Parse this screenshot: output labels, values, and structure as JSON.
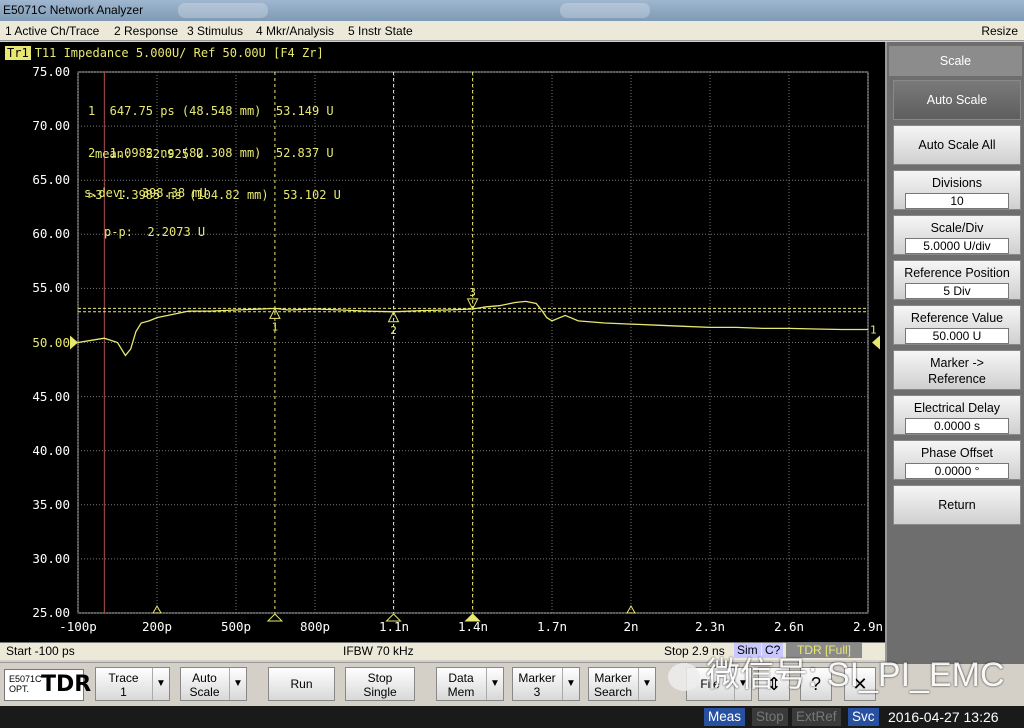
{
  "window": {
    "title": "E5071C Network Analyzer"
  },
  "menu": {
    "items": [
      "1 Active Ch/Trace",
      "2 Response",
      "3 Stimulus",
      "4 Mkr/Analysis",
      "5 Instr State"
    ],
    "resize": "Resize"
  },
  "trace": {
    "tag": "Tr1",
    "header": "T11 Impedance 5.000U/ Ref 50.00U [F4 Zr]"
  },
  "markers_table": [
    "1  647.75 ps (48.548 mm)  53.149 U",
    "2  1.0982 ns (82.308 mm)  52.837 U",
    ">3  1.3985 ns (104.82 mm)  53.102 U"
  ],
  "stats": {
    "mean": "mean:  52.925 U",
    "sdev": "s.dev:  398.38 mU",
    "pp": "p-p:  2.2073 U"
  },
  "chart_data": {
    "type": "line",
    "title": "T11 Impedance",
    "xlabel": "",
    "ylabel": "",
    "x_unit": "ps",
    "y_unit": "U",
    "xlim": [
      -100,
      2900
    ],
    "ylim": [
      25,
      75
    ],
    "yticks": [
      "75.00",
      "70.00",
      "65.00",
      "60.00",
      "55.00",
      "50.00",
      "45.00",
      "40.00",
      "35.00",
      "30.00",
      "25.00"
    ],
    "yticks_values": [
      75,
      70,
      65,
      60,
      55,
      50,
      45,
      40,
      35,
      30,
      25
    ],
    "xticks": [
      "-100p",
      "200p",
      "500p",
      "800p",
      "1.1n",
      "1.4n",
      "1.7n",
      "2n",
      "2.3n",
      "2.6n",
      "2.9n"
    ],
    "xticks_values": [
      -100,
      200,
      500,
      800,
      1100,
      1400,
      1700,
      2000,
      2300,
      2600,
      2900
    ],
    "reference_value": 50,
    "series": [
      {
        "color": "#e8e870",
        "x": [
          -100,
          -50,
          0,
          50,
          80,
          100,
          120,
          140,
          170,
          200,
          260,
          320,
          400,
          500,
          600,
          648,
          700,
          800,
          900,
          1000,
          1098,
          1200,
          1300,
          1399,
          1450,
          1500,
          1560,
          1600,
          1640,
          1660,
          1680,
          1700,
          1720,
          1750,
          1800,
          1900,
          2000,
          2100,
          2200,
          2300,
          2400,
          2500,
          2600,
          2700,
          2800,
          2900
        ],
        "y": [
          50.0,
          50.2,
          50.4,
          50.0,
          48.8,
          49.4,
          51.0,
          51.8,
          52.0,
          52.3,
          52.6,
          52.9,
          52.9,
          53.0,
          53.1,
          53.15,
          53.0,
          53.1,
          53.0,
          52.9,
          52.84,
          52.95,
          53.0,
          53.1,
          53.3,
          53.4,
          53.7,
          53.8,
          53.6,
          53.0,
          52.3,
          52.0,
          52.2,
          52.5,
          52.0,
          51.8,
          51.7,
          51.6,
          51.5,
          51.4,
          51.4,
          51.3,
          51.3,
          51.25,
          51.2,
          51.2
        ]
      }
    ],
    "markers": [
      {
        "label": "1",
        "x": 647.75,
        "y": 53.149
      },
      {
        "label": "2",
        "x": 1098.2,
        "y": 52.837
      },
      {
        "label": "3",
        "x": 1398.5,
        "y": 53.102
      }
    ],
    "stats_lines_y": [
      53.15,
      52.84
    ],
    "grid": true
  },
  "status": {
    "start": "Start -100 ps",
    "ifbw": "IFBW 70 kHz",
    "stop": "Stop 2.9 ns",
    "sim": "Sim",
    "c": "C?",
    "tdr": "TDR [Full]"
  },
  "softkeys": {
    "header": "Scale",
    "auto_scale": "Auto Scale",
    "auto_scale_all": "Auto Scale All",
    "divisions_label": "Divisions",
    "divisions_value": "10",
    "scale_div_label": "Scale/Div",
    "scale_div_value": "5.0000 U/div",
    "ref_pos_label": "Reference Position",
    "ref_pos_value": "5 Div",
    "ref_val_label": "Reference Value",
    "ref_val_value": "50.000 U",
    "marker_ref_l1": "Marker ->",
    "marker_ref_l2": "Reference",
    "elec_delay_label": "Electrical Delay",
    "elec_delay_value": "0.0000 s",
    "phase_offset_label": "Phase Offset",
    "phase_offset_value": "0.0000 °",
    "return": "Return"
  },
  "bottombar": {
    "logo_line1": "E5071C",
    "logo_line2": "OPT.",
    "logo_big": "TDR",
    "trace_l1": "Trace",
    "trace_l2": "1",
    "autoscale_l1": "Auto",
    "autoscale_l2": "Scale",
    "run": "Run",
    "stop_l1": "Stop",
    "stop_l2": "Single",
    "data_l1": "Data",
    "data_l2": "Mem",
    "marker_l1": "Marker",
    "marker_l2": "3",
    "msearch_l1": "Marker",
    "msearch_l2": "Search",
    "file": "File",
    "arrow_glyph": "▼",
    "updown_glyph": "⇕",
    "help_glyph": "?",
    "close_glyph": "✕"
  },
  "taskbar": {
    "meas": "Meas",
    "stop": "Stop",
    "extref": "ExtRef",
    "svc": "Svc",
    "datetime": "2016-04-27 13:26"
  },
  "watermark": {
    "text": "微信号: SI_PI_EMC"
  }
}
